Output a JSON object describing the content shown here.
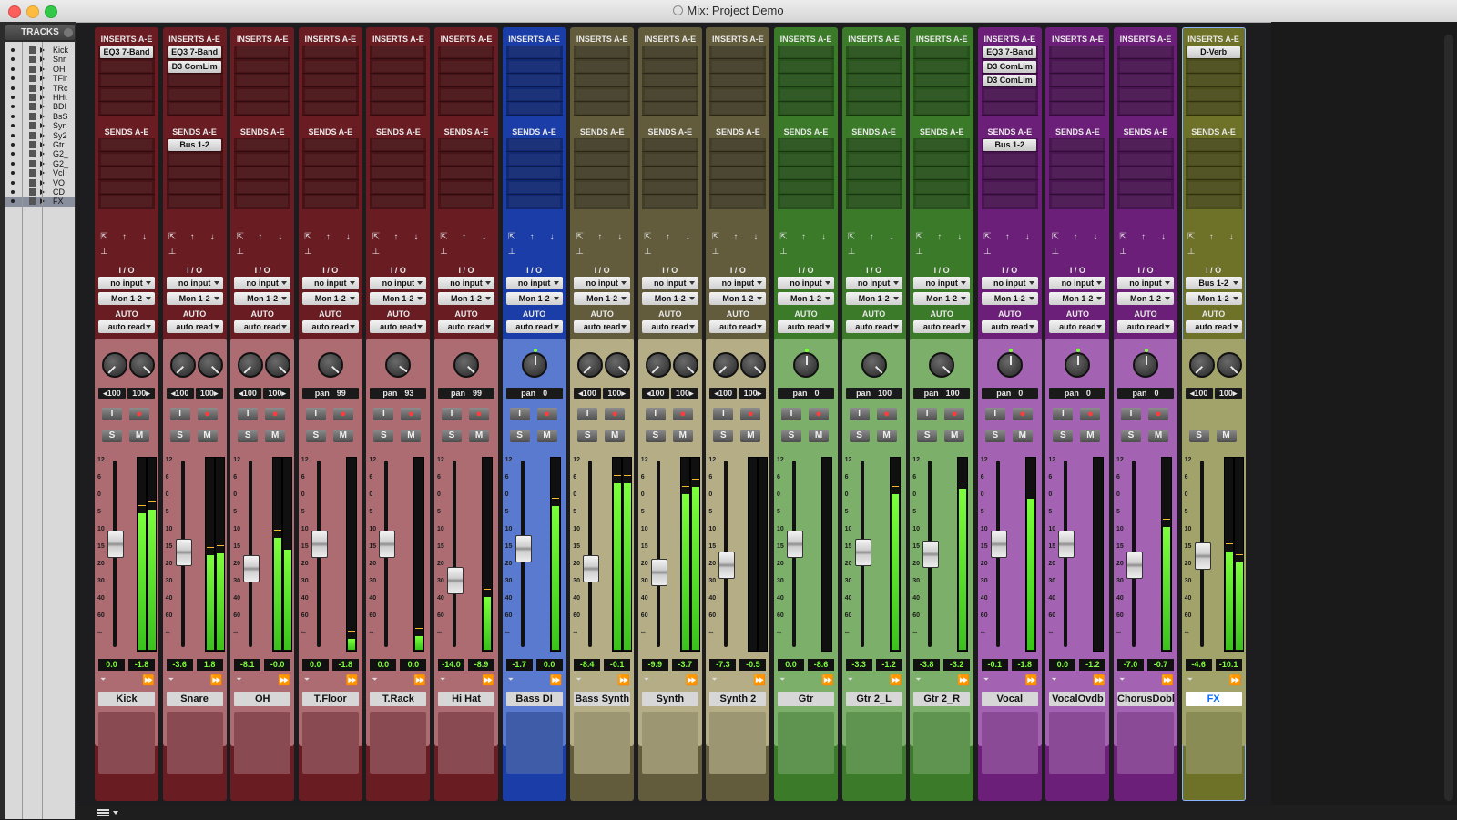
{
  "window": {
    "title": "Mix: Project Demo"
  },
  "tracks_panel": {
    "header": "TRACKS",
    "items": [
      {
        "name": "Kick"
      },
      {
        "name": "Snr"
      },
      {
        "name": "OH"
      },
      {
        "name": "TFlr"
      },
      {
        "name": "TRc"
      },
      {
        "name": "HHt"
      },
      {
        "name": "BDI"
      },
      {
        "name": "BsS"
      },
      {
        "name": "Syn"
      },
      {
        "name": "Sy2"
      },
      {
        "name": "Gtr"
      },
      {
        "name": "G2_"
      },
      {
        "name": "G2_"
      },
      {
        "name": "Vcl"
      },
      {
        "name": "VO"
      },
      {
        "name": "CD"
      },
      {
        "name": "FX"
      }
    ]
  },
  "labels": {
    "inserts": "INSERTS A-E",
    "sends": "SENDS A-E",
    "io": "I / O",
    "auto": "AUTO"
  },
  "buttons": {
    "input": "I",
    "solo": "S",
    "mute": "M",
    "record": "●"
  },
  "icons": {
    "routing": [
      "send-pop-icon",
      "arrow-up-icon",
      "arrow-down-icon"
    ],
    "output": "output-lock-icon",
    "group": "group-triangle-icon",
    "dyn": "fast-forward-icon"
  },
  "colors": {
    "red": "#6a1c23",
    "red_body": "#ad6b72",
    "blue": "#1a3da8",
    "blue_body": "#5a7ad0",
    "olive": "#625c3c",
    "olive_body": "#b4ad86",
    "green": "#3a7a28",
    "green_body": "#7cb06a",
    "purple": "#6c1f78",
    "purple_body": "#a462b2",
    "yellow": "#6e7128",
    "yellow_body": "#a2a36a"
  },
  "strips": [
    {
      "name": "Kick",
      "inserts": [
        "EQ3 7-Band"
      ],
      "sends": [],
      "input": "no input",
      "output": "Mon 1-2",
      "auto": "auto read",
      "pan_l": "100",
      "pan_r": "100",
      "stereo": true,
      "vol": "0.0",
      "peak": "-1.8",
      "fader": 0.55,
      "meter": [
        0.72,
        0.74
      ],
      "color": "red"
    },
    {
      "name": "Snare",
      "inserts": [
        "EQ3 7-Band",
        "D3 ComLim"
      ],
      "sends": [
        "Bus 1-2"
      ],
      "input": "no input",
      "output": "Mon 1-2",
      "auto": "auto read",
      "pan_l": "100",
      "pan_r": "100",
      "stereo": true,
      "vol": "-3.6",
      "peak": "1.8",
      "fader": 0.5,
      "meter": [
        0.5,
        0.51
      ],
      "color": "red"
    },
    {
      "name": "OH",
      "inserts": [],
      "sends": [],
      "input": "no input",
      "output": "Mon 1-2",
      "auto": "auto read",
      "pan_l": "100",
      "pan_r": "100",
      "stereo": true,
      "vol": "-8.1",
      "peak": "-0.0",
      "fader": 0.4,
      "meter": [
        0.59,
        0.53
      ],
      "color": "red"
    },
    {
      "name": "T.Floor",
      "inserts": [],
      "sends": [],
      "input": "no input",
      "output": "Mon 1-2",
      "auto": "auto read",
      "pan_label": "pan",
      "pan_val": "99",
      "stereo": false,
      "vol": "0.0",
      "peak": "-1.8",
      "fader": 0.55,
      "meter": [
        0.06
      ],
      "color": "red"
    },
    {
      "name": "T.Rack",
      "inserts": [],
      "sends": [],
      "input": "no input",
      "output": "Mon 1-2",
      "auto": "auto read",
      "pan_label": "pan",
      "pan_val": "93",
      "stereo": false,
      "vol": "0.0",
      "peak": "0.0",
      "fader": 0.55,
      "meter": [
        0.07
      ],
      "color": "red"
    },
    {
      "name": "Hi Hat",
      "inserts": [],
      "sends": [],
      "input": "no input",
      "output": "Mon 1-2",
      "auto": "auto read",
      "pan_label": "pan",
      "pan_val": "99",
      "stereo": false,
      "vol": "-14.0",
      "peak": "-8.9",
      "fader": 0.33,
      "meter": [
        0.28
      ],
      "color": "red"
    },
    {
      "name": "Bass DI",
      "inserts": [],
      "sends": [],
      "input": "no input",
      "output": "Mon 1-2",
      "auto": "auto read",
      "pan_label": "pan",
      "pan_val": "0",
      "stereo": false,
      "vol": "-1.7",
      "peak": "0.0",
      "fader": 0.52,
      "meter": [
        0.76
      ],
      "color": "blue"
    },
    {
      "name": "Bass Synth",
      "inserts": [],
      "sends": [],
      "input": "no input",
      "output": "Mon 1-2",
      "auto": "auto read",
      "pan_l": "100",
      "pan_r": "100",
      "stereo": true,
      "vol": "-8.4",
      "peak": "-0.1",
      "fader": 0.4,
      "meter": [
        0.88,
        0.88
      ],
      "color": "olive"
    },
    {
      "name": "Synth",
      "inserts": [],
      "sends": [],
      "input": "no input",
      "output": "Mon 1-2",
      "auto": "auto read",
      "pan_l": "100",
      "pan_r": "100",
      "stereo": true,
      "vol": "-9.9",
      "peak": "-3.7",
      "fader": 0.38,
      "meter": [
        0.82,
        0.86
      ],
      "color": "olive"
    },
    {
      "name": "Synth 2",
      "inserts": [],
      "sends": [],
      "input": "no input",
      "output": "Mon 1-2",
      "auto": "auto read",
      "pan_l": "100",
      "pan_r": "100",
      "stereo": true,
      "vol": "-7.3",
      "peak": "-0.5",
      "fader": 0.42,
      "meter": [
        0.0,
        0.0
      ],
      "color": "olive"
    },
    {
      "name": "Gtr",
      "inserts": [],
      "sends": [],
      "input": "no input",
      "output": "Mon 1-2",
      "auto": "auto read",
      "pan_label": "pan",
      "pan_val": "0",
      "stereo": false,
      "vol": "0.0",
      "peak": "-8.6",
      "fader": 0.55,
      "meter": [
        0.0
      ],
      "color": "green"
    },
    {
      "name": "Gtr 2_L",
      "inserts": [],
      "sends": [],
      "input": "no input",
      "output": "Mon 1-2",
      "auto": "auto read",
      "pan_label": "pan",
      "pan_val": "100",
      "stereo": false,
      "vol": "-3.3",
      "peak": "-1.2",
      "fader": 0.5,
      "meter": [
        0.82
      ],
      "color": "green"
    },
    {
      "name": "Gtr 2_R",
      "inserts": [],
      "sends": [],
      "input": "no input",
      "output": "Mon 1-2",
      "auto": "auto read",
      "pan_label": "pan",
      "pan_val": "100",
      "stereo": false,
      "vol": "-3.8",
      "peak": "-3.2",
      "fader": 0.49,
      "meter": [
        0.85
      ],
      "color": "green"
    },
    {
      "name": "Vocal",
      "inserts": [
        "EQ3 7-Band",
        "D3 ComLim",
        "D3 ComLim"
      ],
      "sends": [
        "Bus 1-2"
      ],
      "input": "no input",
      "output": "Mon 1-2",
      "auto": "auto read",
      "pan_label": "pan",
      "pan_val": "0",
      "stereo": false,
      "vol": "-0.1",
      "peak": "-1.8",
      "fader": 0.55,
      "meter": [
        0.8
      ],
      "color": "purple"
    },
    {
      "name": "VocalOvdb",
      "inserts": [],
      "sends": [],
      "input": "no input",
      "output": "Mon 1-2",
      "auto": "auto read",
      "pan_label": "pan",
      "pan_val": "0",
      "stereo": false,
      "vol": "0.0",
      "peak": "-1.2",
      "fader": 0.55,
      "meter": [
        0.0
      ],
      "color": "purple"
    },
    {
      "name": "ChorusDobl",
      "inserts": [],
      "sends": [],
      "input": "no input",
      "output": "Mon 1-2",
      "auto": "auto read",
      "pan_label": "pan",
      "pan_val": "0",
      "stereo": false,
      "vol": "-7.0",
      "peak": "-0.7",
      "fader": 0.42,
      "meter": [
        0.65
      ],
      "color": "purple"
    },
    {
      "name": "FX",
      "inserts": [
        "D-Verb"
      ],
      "sends": [],
      "input": "Bus 1-2",
      "output": "Mon 1-2",
      "auto": "auto read",
      "pan_l": "100",
      "pan_r": "100",
      "stereo": true,
      "vol": "-4.6",
      "peak": "-10.1",
      "fader": 0.48,
      "meter": [
        0.52,
        0.46
      ],
      "color": "yellow",
      "selected": true,
      "no_rec": true
    }
  ]
}
